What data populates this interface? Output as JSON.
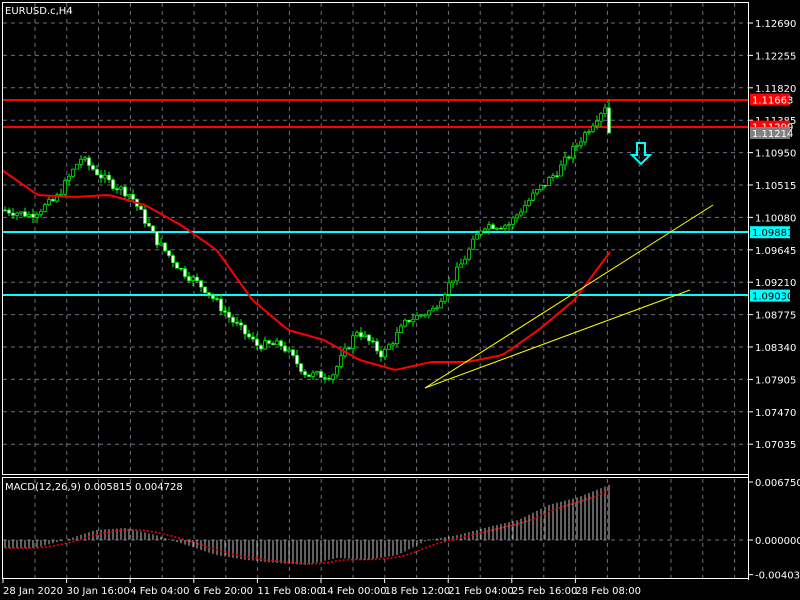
{
  "chart_title": "EURUSD.c,H4",
  "macd_label": "MACD(12,26,9) 0.005815 0.004728",
  "colors": {
    "background": "#000000",
    "grid": "#6b7280",
    "candle": "#00ff00",
    "ma": "#ff0000",
    "resistance": "#ff0000",
    "support": "#00ffff",
    "trendline": "#ffff00",
    "macd_hist": "#c0c0c0",
    "macd_signal": "#ff0000"
  },
  "price_axis": [
    "1.12690",
    "1.12255",
    "1.11820",
    "1.11385",
    "1.10950",
    "1.10515",
    "1.10080",
    "1.09645",
    "1.09210",
    "1.08775",
    "1.08340",
    "1.07905",
    "1.07470",
    "1.07035"
  ],
  "price_tags": [
    {
      "value": "1.11663",
      "kind": "resistance"
    },
    {
      "value": "1.11299",
      "kind": "resistance"
    },
    {
      "value": "1.11214",
      "kind": "bid"
    },
    {
      "value": "1.09881",
      "kind": "support"
    },
    {
      "value": "1.09030",
      "kind": "support"
    }
  ],
  "macd_axis": [
    "0.006750",
    "0.000000",
    "-0.004030"
  ],
  "time_axis": [
    "28 Jan 2020",
    "30 Jan 16:00",
    "4 Feb 04:00",
    "6 Feb 20:00",
    "11 Feb 08:00",
    "14 Feb 00:00",
    "18 Feb 12:00",
    "21 Feb 04:00",
    "25 Feb 16:00",
    "28 Feb 08:00"
  ],
  "chart_data": {
    "type": "candlestick",
    "symbol": "EURUSD.c",
    "timeframe": "H4",
    "ylim": [
      1.0685,
      1.1295
    ],
    "close_waypoints": [
      1.10179,
      1.10112,
      1.10314,
      1.10877,
      1.10582,
      1.10381,
      1.09777,
      1.09374,
      1.09105,
      1.08702,
      1.08367,
      1.08367,
      1.07964,
      1.07964,
      1.08568,
      1.08233,
      1.08702,
      1.08837,
      1.09374,
      1.09978,
      1.09978,
      1.10381,
      1.10716,
      1.11186,
      1.11656
    ],
    "ma_waypoints": [
      1.10716,
      1.10381,
      1.10354,
      1.10381,
      1.10246,
      1.09978,
      1.09642,
      1.08971,
      1.08568,
      1.08434,
      1.08166,
      1.08031,
      1.08139,
      1.08139,
      1.08233,
      1.08568,
      1.08971,
      1.09615
    ],
    "macd": {
      "params": "12,26,9",
      "ylim": [
        -0.00403,
        0.00675
      ],
      "histogram_waypoints": [
        -0.00093,
        -0.00093,
        0,
        0.00116,
        0.0014,
        0.00058,
        -0.00058,
        -0.00175,
        -0.00233,
        -0.00268,
        -0.00291,
        -0.00209,
        -0.00233,
        -0.00175,
        0,
        0.00058,
        0.00151,
        0.00233,
        0.00407,
        0.005,
        0.0064
      ],
      "main": 0.005815,
      "signal": 0.004728
    }
  }
}
